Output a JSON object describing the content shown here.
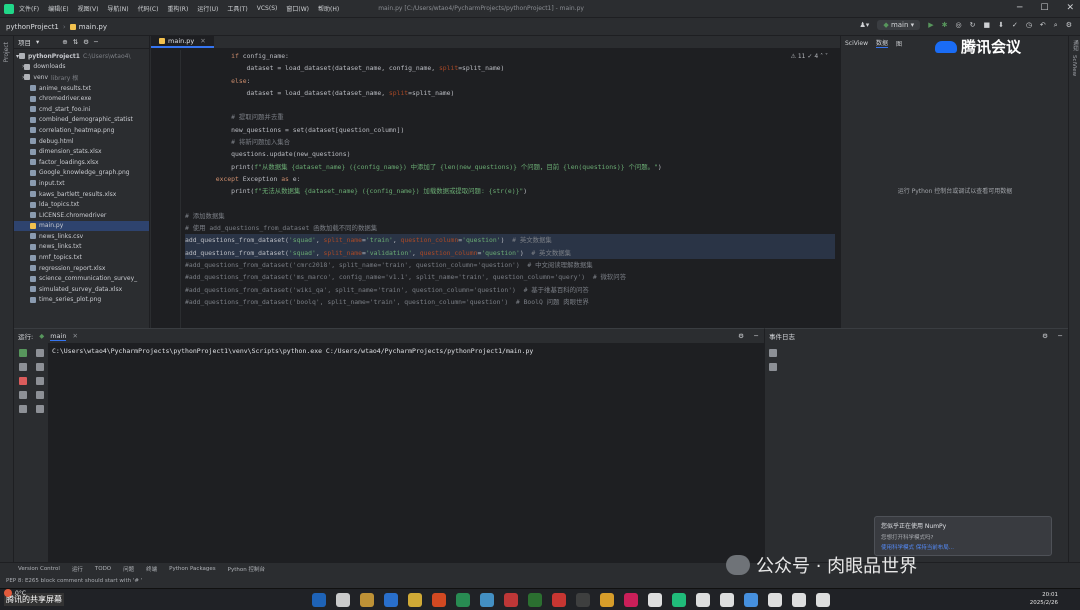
{
  "menubar": {
    "items": [
      "文件(F)",
      "编辑(E)",
      "视图(V)",
      "导航(N)",
      "代码(C)",
      "重构(R)",
      "运行(U)",
      "工具(T)",
      "VCS(S)",
      "窗口(W)",
      "帮助(H)"
    ],
    "window_title": "main.py [C:/Users/wtao4/PycharmProjects/pythonProject1] - main.py"
  },
  "navbar": {
    "project": "pythonProject1",
    "file": "main.py",
    "run_config": "main"
  },
  "project_panel": {
    "header": "项目",
    "root": "pythonProject1",
    "root_path": "C:\\Users\\wtao4\\",
    "items": [
      {
        "name": "downloads",
        "type": "folder"
      },
      {
        "name": "venv",
        "note": "library 根",
        "type": "folder"
      },
      {
        "name": "anime_results.txt",
        "type": "file"
      },
      {
        "name": "chromedriver.exe",
        "type": "file"
      },
      {
        "name": "cmd_start_foo.ini",
        "type": "file"
      },
      {
        "name": "combined_demographic_statist",
        "type": "file"
      },
      {
        "name": "correlation_heatmap.png",
        "type": "file"
      },
      {
        "name": "debug.html",
        "type": "file"
      },
      {
        "name": "dimension_stats.xlsx",
        "type": "file"
      },
      {
        "name": "factor_loadings.xlsx",
        "type": "file"
      },
      {
        "name": "Google_knowledge_graph.png",
        "type": "file"
      },
      {
        "name": "input.txt",
        "type": "file"
      },
      {
        "name": "kaws_bartlett_results.xlsx",
        "type": "file"
      },
      {
        "name": "lda_topics.txt",
        "type": "file"
      },
      {
        "name": "LICENSE.chromedriver",
        "type": "file"
      },
      {
        "name": "main.py",
        "type": "file"
      },
      {
        "name": "news_links.csv",
        "type": "file"
      },
      {
        "name": "news_links.txt",
        "type": "file"
      },
      {
        "name": "nmf_topics.txt",
        "type": "file"
      },
      {
        "name": "regression_report.xlsx",
        "type": "file"
      },
      {
        "name": "science_communication_survey_",
        "type": "file"
      },
      {
        "name": "simulated_survey_data.xlsx",
        "type": "file"
      },
      {
        "name": "time_series_plot.png",
        "type": "file"
      }
    ]
  },
  "editor": {
    "tab": "main.py",
    "inspections": "⚠ 11  ✓ 4",
    "line_numbers": [
      "",
      "",
      "",
      "",
      "",
      "",
      "",
      "",
      "",
      "",
      "",
      "",
      "",
      "",
      "",
      "",
      "",
      "",
      "",
      "",
      "",
      "",
      ""
    ],
    "lines": [
      [
        {
          "t": "            "
        },
        {
          "t": "if",
          "c": "kw"
        },
        {
          "t": " config_name:"
        }
      ],
      [
        {
          "t": "                dataset = load_dataset(dataset_name, config_name, "
        },
        {
          "t": "split",
          "c": "pm"
        },
        {
          "t": "=split_name)"
        }
      ],
      [
        {
          "t": "            "
        },
        {
          "t": "else",
          "c": "kw"
        },
        {
          "t": ":"
        }
      ],
      [
        {
          "t": "                dataset = load_dataset(dataset_name, "
        },
        {
          "t": "split",
          "c": "pm"
        },
        {
          "t": "=split_name)"
        }
      ],
      [
        {
          "t": ""
        }
      ],
      [
        {
          "t": "            "
        },
        {
          "t": "# 提取问题并去重",
          "c": "cm"
        }
      ],
      [
        {
          "t": "            new_questions = set(dataset[question_column])"
        }
      ],
      [
        {
          "t": "            "
        },
        {
          "t": "# 将新问题加入集合",
          "c": "cm"
        }
      ],
      [
        {
          "t": "            questions.update(new_questions)"
        }
      ],
      [
        {
          "t": "            print("
        },
        {
          "t": "f\"从数据集 {dataset_name} ({config_name}) 中添加了 {len(new_questions)} 个问题，目前 {len(questions)} 个问题。\"",
          "c": "st"
        },
        {
          "t": ")"
        }
      ],
      [
        {
          "t": "        "
        },
        {
          "t": "except",
          "c": "kw"
        },
        {
          "t": " Exception "
        },
        {
          "t": "as",
          "c": "kw"
        },
        {
          "t": " e:"
        }
      ],
      [
        {
          "t": "            print("
        },
        {
          "t": "f\"无法从数据集 {dataset_name} ({config_name}) 加载数据或提取问题: {str(e)}\"",
          "c": "st"
        },
        {
          "t": ")"
        }
      ],
      [
        {
          "t": ""
        }
      ],
      [
        {
          "t": "# 添加数据集",
          "c": "cm"
        }
      ],
      [
        {
          "t": "# 使用 add_questions_from_dataset 函数加载不同的数据集",
          "c": "cm"
        }
      ],
      [
        {
          "t": "add_questions_from_dataset("
        },
        {
          "t": "'squad'",
          "c": "st"
        },
        {
          "t": ", "
        },
        {
          "t": "split_name",
          "c": "pm"
        },
        {
          "t": "="
        },
        {
          "t": "'train'",
          "c": "st"
        },
        {
          "t": ", "
        },
        {
          "t": "question_column",
          "c": "pm"
        },
        {
          "t": "="
        },
        {
          "t": "'question'",
          "c": "st"
        },
        {
          "t": ")  "
        },
        {
          "t": "# 英文数据集",
          "c": "cm"
        }
      ],
      [
        {
          "t": "add_questions_from_dataset("
        },
        {
          "t": "'squad'",
          "c": "st"
        },
        {
          "t": ", "
        },
        {
          "t": "split_name",
          "c": "pm"
        },
        {
          "t": "="
        },
        {
          "t": "'validation'",
          "c": "st"
        },
        {
          "t": ", "
        },
        {
          "t": "question_column",
          "c": "pm"
        },
        {
          "t": "="
        },
        {
          "t": "'question'",
          "c": "st"
        },
        {
          "t": ")  "
        },
        {
          "t": "# 英文数据集",
          "c": "cm"
        }
      ],
      [
        {
          "t": "#add_questions_from_dataset('cmrc2018', split_name='train', question_column='question')  # 中文阅读理解数据集",
          "c": "cm"
        }
      ],
      [
        {
          "t": "#add_questions_from_dataset('ms_marco', config_name='v1.1', split_name='train', question_column='query')  # 微软问答",
          "c": "cm"
        }
      ],
      [
        {
          "t": "#add_questions_from_dataset('wiki_qa', split_name='train', question_column='question')  # 基于维基百科的问答",
          "c": "cm"
        }
      ],
      [
        {
          "t": "#add_questions_from_dataset('boolq', split_name='train', question_column='question')  # BoolQ 问题 肉眼世界",
          "c": "cm"
        }
      ]
    ]
  },
  "right_panel": {
    "tabs": [
      "SciView",
      "数据",
      "图"
    ],
    "hint": "运行 Python 控制台或调试以查看可用数据"
  },
  "tencent_meeting": {
    "label": "腾讯会议"
  },
  "right_strip": {
    "items": [
      "通知",
      "SciView"
    ]
  },
  "run_panel": {
    "header": "运行:",
    "tab": "main",
    "command": "C:\\Users\\wtao4\\PycharmProjects\\pythonProject1\\venv\\Scripts\\python.exe C:/Users/wtao4/PycharmProjects/pythonProject1/main.py"
  },
  "event_panel": {
    "header": "事件日志"
  },
  "notification": {
    "title": "您似乎正在使用 NumPy",
    "body": "您想打开科学模式吗?",
    "link": "使用科学模式   保持当前布局..."
  },
  "bottom_toolbar": {
    "items": [
      "Version Control",
      "运行",
      "TODO",
      "问题",
      "终端",
      "Python Packages",
      "Python 控制台"
    ]
  },
  "statusbar": {
    "text": "PEP 8: E265 block comment should start with '# '"
  },
  "watermark": {
    "text": "公众号 · 肉眼品世界"
  },
  "taskbar": {
    "share_label": "腾讯的共享屏幕",
    "weather": "0°C",
    "time": "20:01",
    "date": "2025/2/26",
    "icon_colors": [
      "#1f6fd1",
      "#e9e9e9",
      "#dba63a",
      "#2b7de9",
      "#f0c23a",
      "#f25022",
      "#2a9d5a",
      "#4aa3df",
      "#d93b3b",
      "#2e7d32",
      "#e53935",
      "#444444",
      "#f7b32b",
      "#e91e63",
      "#ffffff",
      "#21d789",
      "#ffffff",
      "#ffffff",
      "#4da3ff",
      "#ffffff",
      "#ffffff",
      "#ffffff"
    ]
  }
}
